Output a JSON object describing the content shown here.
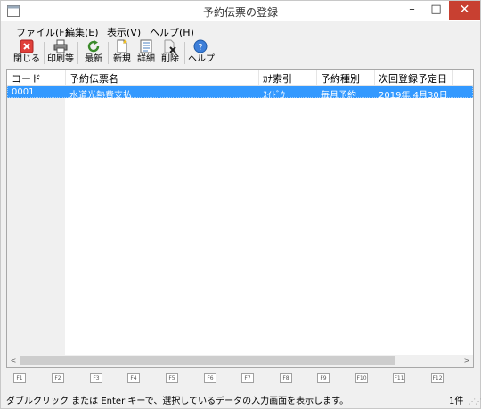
{
  "window": {
    "title": "予約伝票の登録",
    "minimize_glyph": "–",
    "maximize_glyph": "□",
    "close_glyph": "✕"
  },
  "menu": [
    {
      "label": "ファイル(F)"
    },
    {
      "label": "編集(E)"
    },
    {
      "label": "表示(V)"
    },
    {
      "label": "ヘルプ(H)"
    }
  ],
  "toolbar": {
    "close_label": "閉じる",
    "print_label": "印刷等",
    "refresh_label": "最新",
    "new_label": "新規",
    "detail_label": "詳細",
    "delete_label": "削除",
    "help_label": "ヘルプ"
  },
  "list": {
    "columns": [
      "コード",
      "予約伝票名",
      "ｶﾅ索引",
      "予約種別",
      "次回登録予定日"
    ],
    "rows": [
      {
        "code": "0001",
        "name": "水道光熱費支払",
        "kana": "ｽｲﾄﾞｳ",
        "type": "毎月予約",
        "next_date": "2019年 4月30日"
      }
    ]
  },
  "scrollbar": {
    "left_glyph": "<",
    "right_glyph": ">"
  },
  "function_keys": [
    "F1",
    "F2",
    "F3",
    "F4",
    "F5",
    "F6",
    "F7",
    "F8",
    "F9",
    "F10",
    "F11",
    "F12"
  ],
  "status": {
    "message": "ダブルクリック または Enter キーで、選択しているデータの入力画面を表示します。",
    "count": "1件",
    "grip": "⋰⋰"
  },
  "colors": {
    "selection": "#3399ff",
    "close_button": "#c84031"
  }
}
